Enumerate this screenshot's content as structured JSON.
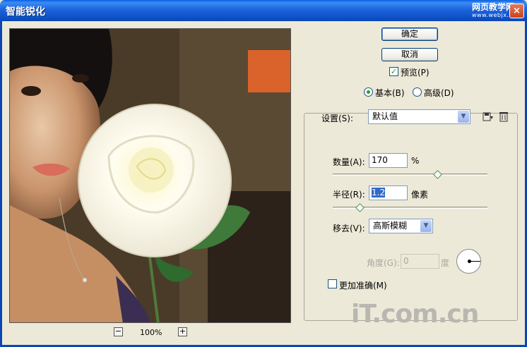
{
  "window": {
    "title": "智能锐化",
    "close_label": "×"
  },
  "watermark_top": {
    "line1": "网页教学网",
    "line2": "www.webjx.com"
  },
  "buttons": {
    "ok": "确定",
    "cancel": "取消"
  },
  "preview_check": {
    "checked": "✓",
    "label": "预览(P)"
  },
  "mode": {
    "basic": "基本(B)",
    "advanced": "高级(D)",
    "selected": "basic"
  },
  "settings": {
    "label": "设置(S):",
    "value": "默认值",
    "save_icon": "save-preset-icon",
    "delete_icon": "trash-icon"
  },
  "amount": {
    "label": "数量(A):",
    "value": "170",
    "unit": "%",
    "slider_fraction": 0.68
  },
  "radius": {
    "label": "半径(R):",
    "value": "1.2",
    "unit": "像素",
    "slider_fraction": 0.18
  },
  "remove": {
    "label": "移去(V):",
    "value": "高斯模糊"
  },
  "angle": {
    "label": "角度(G):",
    "value": "0",
    "unit": "度"
  },
  "more_accurate": {
    "checked": "",
    "label": "更加准确(M)"
  },
  "zoom": {
    "minus": "−",
    "level": "100%",
    "plus": "+"
  },
  "watermark_bottom": "iT.com.cn"
}
